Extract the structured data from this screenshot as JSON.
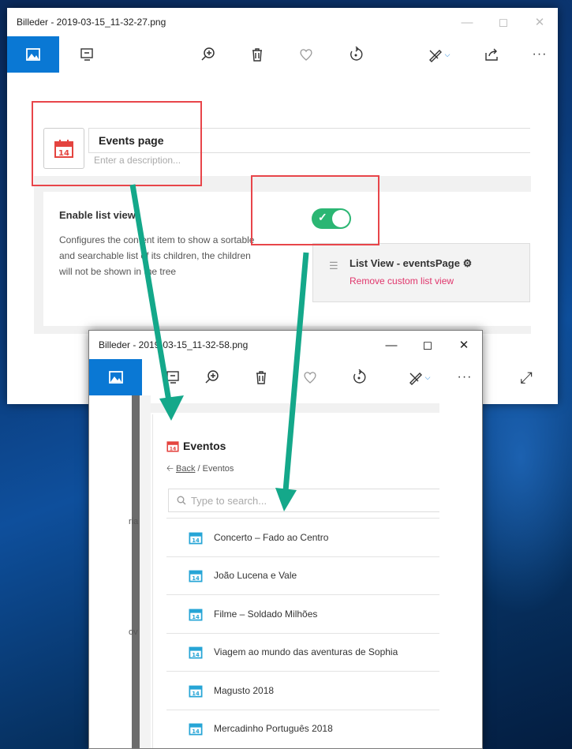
{
  "window1": {
    "title": "Billeder - 2019-03-15_11-32-27.png",
    "node_name": "Events page",
    "description_placeholder": "Enter a description...",
    "property_title": "Enable list view",
    "property_description": "Configures the content item to show a sortable and searchable list of its children, the children will not be shown in the tree",
    "list_view_name": "List View - eventsPage",
    "remove_label": "Remove custom list view",
    "calendar_day": "14"
  },
  "window2": {
    "title": "Billeder - 2019-03-15_11-32-58.png",
    "page_title": "Eventos",
    "back_label": "Back",
    "breadcrumb_sep": "/",
    "breadcrumb_current": "Eventos",
    "search_placeholder": "Type to search...",
    "left_fragment_1": "ria",
    "left_fragment_2": "ov",
    "items": [
      "Concerto – Fado ao Centro",
      "João Lucena e Vale",
      "Filme – Soldado Milhões",
      "Viagem ao mundo das aventuras de Sophia",
      "Magusto 2018",
      "Mercadinho Português 2018"
    ]
  },
  "colors": {
    "accent": "#0a78d4",
    "toggle_on": "#2bb673",
    "highlight": "#e8454a",
    "arrow": "#14a88a",
    "remove": "#e0366c"
  }
}
